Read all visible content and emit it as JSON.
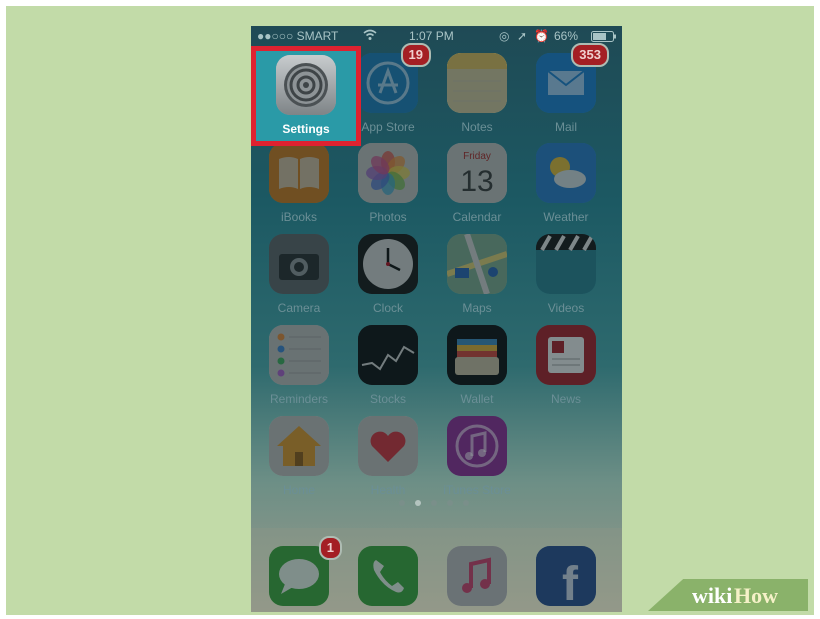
{
  "status_bar": {
    "carrier": "●●○○○ SMART",
    "time": "1:07 PM",
    "battery": "66%"
  },
  "apps": [
    {
      "label": "Settings",
      "icon": "gear-icon",
      "color": "#9aa0a3"
    },
    {
      "label": "App Store",
      "icon": "app-store-icon",
      "color": "#1f7ab5",
      "badge": "19"
    },
    {
      "label": "Notes",
      "icon": "notes-icon",
      "color": "#c7b46a"
    },
    {
      "label": "Mail",
      "icon": "mail-icon",
      "color": "#1e7dc9",
      "badge": "353"
    },
    {
      "label": "iBooks",
      "icon": "book-icon",
      "color": "#c47722"
    },
    {
      "label": "Photos",
      "icon": "photos-icon",
      "color": "#b9b9b6"
    },
    {
      "label": "Calendar",
      "icon": "calendar-icon",
      "color": "#b9b9b6",
      "weekday": "Friday",
      "day": "13"
    },
    {
      "label": "Weather",
      "icon": "weather-icon",
      "color": "#2a78c2"
    },
    {
      "label": "Camera",
      "icon": "camera-icon",
      "color": "#5e6366"
    },
    {
      "label": "Clock",
      "icon": "clock-icon",
      "color": "#1a1a1a"
    },
    {
      "label": "Maps",
      "icon": "maps-icon",
      "color": "#7aa58b"
    },
    {
      "label": "Videos",
      "icon": "clapper-icon",
      "color": "#2b7e8d"
    },
    {
      "label": "Reminders",
      "icon": "reminders-icon",
      "color": "#b6b6b4"
    },
    {
      "label": "Stocks",
      "icon": "stocks-icon",
      "color": "#111314"
    },
    {
      "label": "Wallet",
      "icon": "wallet-icon",
      "color": "#111314"
    },
    {
      "label": "News",
      "icon": "news-icon",
      "color": "#a3222b"
    },
    {
      "label": "Home",
      "icon": "home-icon",
      "color": "#b8b7b4"
    },
    {
      "label": "Health",
      "icon": "heart-icon",
      "color": "#b8b7b4"
    },
    {
      "label": "iTunes Store",
      "icon": "itunes-icon",
      "color": "#8a2f92"
    }
  ],
  "dock": [
    {
      "label": "Messages",
      "icon": "messages-icon",
      "color": "#3fa33d",
      "badge": "1"
    },
    {
      "label": "Phone",
      "icon": "phone-icon",
      "color": "#3ca23c"
    },
    {
      "label": "Music",
      "icon": "music-icon",
      "color": "#b8b6b8"
    },
    {
      "label": "Facebook",
      "icon": "facebook-icon",
      "color": "#2d4f8d"
    }
  ],
  "page_indicator": {
    "count": 5,
    "active": 1
  },
  "highlight_color": "#de2230",
  "watermark": {
    "part1": "wiki",
    "part2": "How"
  }
}
